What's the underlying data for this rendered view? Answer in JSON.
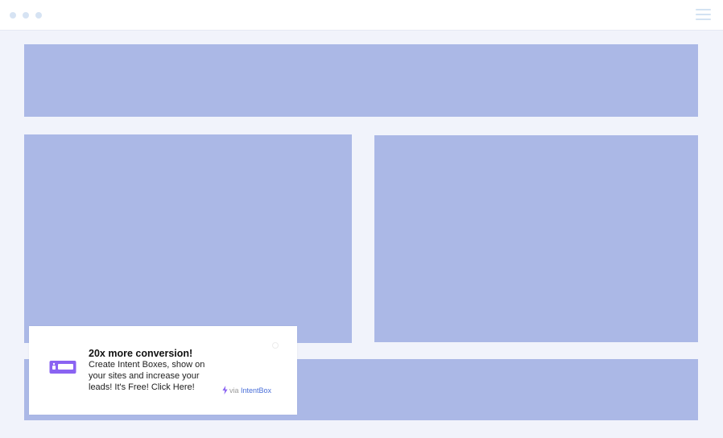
{
  "window": {
    "controls": [
      "dot",
      "dot",
      "dot"
    ],
    "menu_icon": "hamburger-icon"
  },
  "notification": {
    "title": "20x more conversion!",
    "body": "Create Intent Boxes, show on your sites and increase your leads! It's Free! Click Here!",
    "via_label": "via",
    "brand": "IntentBox",
    "icon": "intentbox-logo-icon",
    "accent_color": "#8a63f2",
    "brand_color": "#4a6fd8"
  },
  "colors": {
    "placeholder": "#abb8e6",
    "background": "#f1f3fb"
  }
}
